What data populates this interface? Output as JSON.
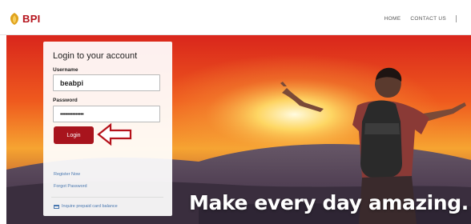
{
  "header": {
    "logo_text": "BPI",
    "nav": [
      {
        "label": "HOME"
      },
      {
        "label": "CONTACT US"
      }
    ]
  },
  "login": {
    "title": "Login to your account",
    "username_label": "Username",
    "username_value": "beabpi",
    "password_label": "Password",
    "password_value": "•••••••••••••••",
    "login_button": "Login",
    "register_link": "Register Now",
    "forgot_link": "Forgot Password",
    "card_link": "Inquire prepaid card balance"
  },
  "hero": {
    "tagline": "Make every day amazing."
  },
  "colors": {
    "brand_red": "#a8141d",
    "link_blue": "#4a78b0",
    "arrow_red": "#b5121b"
  }
}
